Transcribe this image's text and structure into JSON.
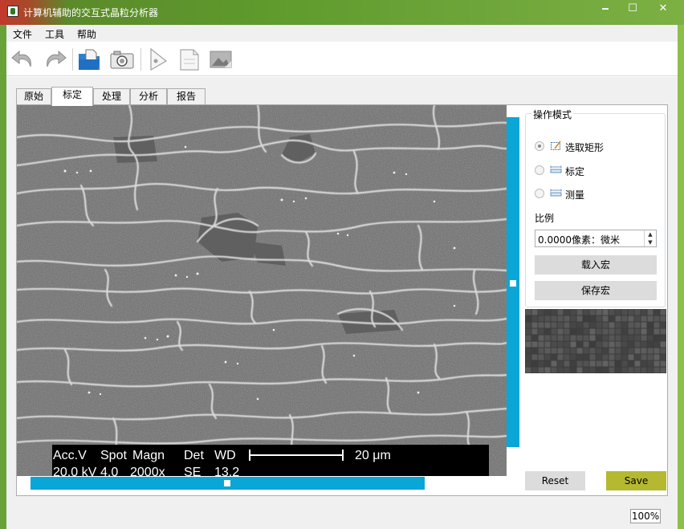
{
  "window": {
    "title": "计算机辅助的交互式晶粒分析器",
    "minimize_glyph": "🗕",
    "maximize_glyph": "☐",
    "close_glyph": "✕"
  },
  "menu": {
    "items": [
      "文件",
      "工具",
      "帮助"
    ]
  },
  "toolbar": {
    "buttons": [
      "undo-icon",
      "redo-icon",
      "open-folder-icon",
      "camera-icon",
      "pen-tool-icon",
      "document-icon",
      "image-icon"
    ]
  },
  "tabs": {
    "items": [
      "原始",
      "标定",
      "处理",
      "分析",
      "报告"
    ],
    "active": "标定"
  },
  "image": {
    "databar": {
      "headers": [
        "Acc.V",
        "Spot",
        "Magn",
        "Det",
        "WD"
      ],
      "values": [
        "20.0 kV",
        "4.0",
        "2000x",
        "SE",
        "13.2"
      ],
      "scale_label": "20 μm"
    }
  },
  "mode_panel": {
    "title": "操作模式",
    "options": [
      {
        "label": "选取矩形",
        "icon": "select-rectangle-icon",
        "checked": true
      },
      {
        "label": "标定",
        "icon": "calibrate-ruler-icon",
        "checked": false
      },
      {
        "label": "测量",
        "icon": "measure-ruler-icon",
        "checked": false
      }
    ],
    "ratio_label": "比例",
    "ratio_value": "0.0000像素：微米",
    "load_macro_label": "载入宏",
    "save_macro_label": "保存宏"
  },
  "actions": {
    "reset_label": "Reset",
    "save_label": "Save"
  },
  "status": {
    "zoom": "100%"
  },
  "colors": {
    "accent_scroll": "#0aa6d8",
    "save_button": "#b4b930",
    "window_frame": "#6aa23a"
  }
}
